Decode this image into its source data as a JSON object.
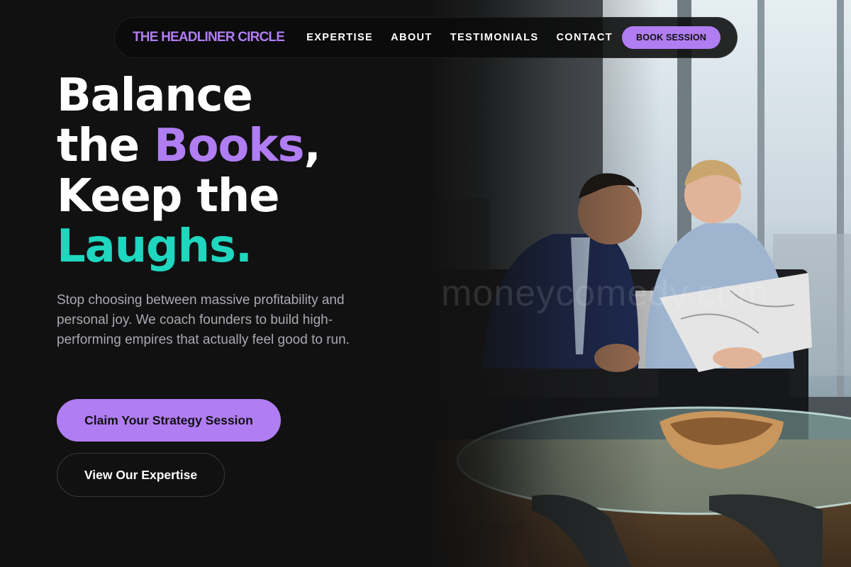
{
  "nav": {
    "brand": "THE HEADLINER CIRCLE",
    "links": [
      "EXPERTISE",
      "ABOUT",
      "TESTIMONIALS",
      "CONTACT"
    ],
    "cta": "BOOK SESSION"
  },
  "hero": {
    "headline": {
      "line1": "Balance",
      "line2_prefix": "the ",
      "line2_accent": "Books",
      "line2_suffix": ",",
      "line3": "Keep the",
      "line4": "Laughs."
    },
    "subtitle": "Stop choosing between massive profitability and personal joy. We coach founders to build high-performing empires that actually feel good to run.",
    "primary_cta": "Claim Your Strategy Session",
    "secondary_cta": "View Our Expertise",
    "watermark": "moneycomedy.com"
  },
  "colors": {
    "background": "#111111",
    "accent_purple": "#b07df3",
    "accent_teal": "#1fd6bf",
    "muted_text": "#a9a9b2"
  },
  "image": {
    "subject": "two businessmen laughing at a laptop on a sofa beside a glass coffee table with a wooden bowl"
  }
}
